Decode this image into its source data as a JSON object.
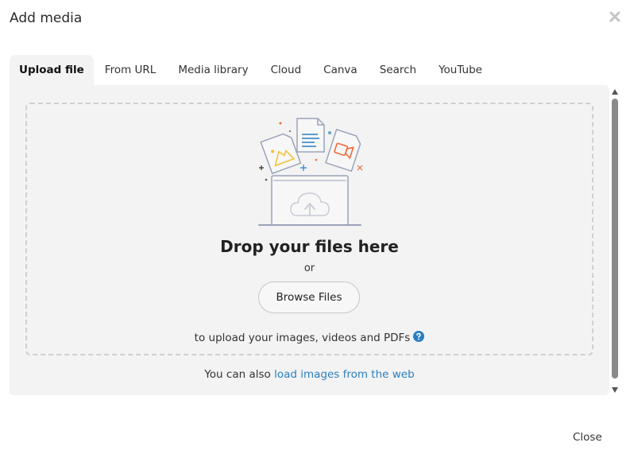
{
  "dialog": {
    "title": "Add media",
    "close_icon": "close-x-icon"
  },
  "tabs": [
    {
      "label": "Upload file",
      "active": true
    },
    {
      "label": "From URL",
      "active": false
    },
    {
      "label": "Media library",
      "active": false
    },
    {
      "label": "Cloud",
      "active": false
    },
    {
      "label": "Canva",
      "active": false
    },
    {
      "label": "Search",
      "active": false
    },
    {
      "label": "YouTube",
      "active": false
    }
  ],
  "upload": {
    "heading": "Drop your files here",
    "or_text": "or",
    "browse_label": "Browse Files",
    "note": "to upload your images, videos and PDFs",
    "help_icon": "question-circle-icon",
    "illustration_icon": "upload-files-illustration"
  },
  "footer": {
    "web_prefix": "You can also ",
    "web_link": "load images from the web",
    "close_label": "Close"
  },
  "colors": {
    "link": "#2a7fbf",
    "panel_bg": "#f3f3f3",
    "help_icon": "#2a7fbf",
    "illustration_stroke": "#9aa3b8",
    "image_accent": "#f2c230",
    "doc_accent": "#2a7fbf",
    "video_accent": "#f06a3a"
  }
}
